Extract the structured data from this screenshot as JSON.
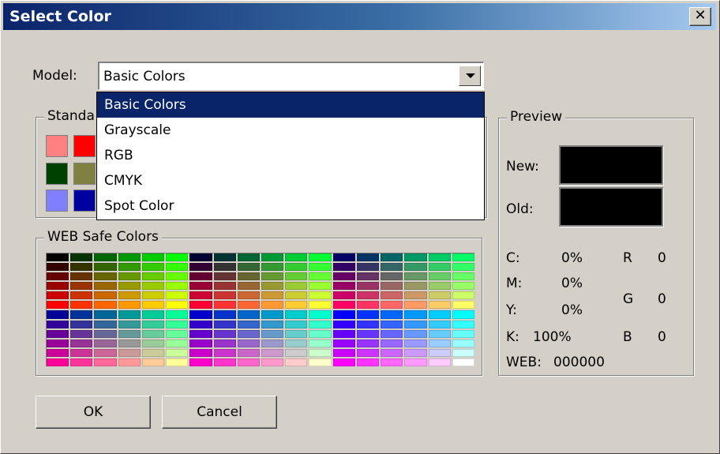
{
  "window": {
    "title": "Select Color"
  },
  "model": {
    "label": "Model:",
    "value": "Basic Colors",
    "options": [
      "Basic Colors",
      "Grayscale",
      "RGB",
      "CMYK",
      "Spot Color"
    ]
  },
  "standard": {
    "title": "Standa",
    "swatches": [
      "#ff8080",
      "#ff0000",
      "#004000",
      "#808040",
      "#8080ff",
      "#0000a0"
    ]
  },
  "web_safe": {
    "title": "WEB Safe Colors"
  },
  "preview": {
    "title": "Preview",
    "new_label": "New:",
    "old_label": "Old:",
    "new_color": "#000000",
    "old_color": "#000000"
  },
  "values": {
    "c_label": "C:",
    "c_value": "0%",
    "m_label": "M:",
    "m_value": "0%",
    "y_label": "Y:",
    "y_value": "0%",
    "k_label": "K:",
    "k_value": "100%",
    "r_label": "R",
    "r_value": "0",
    "g_label": "G",
    "g_value": "0",
    "b_label": "B",
    "b_value": "0",
    "web_label": "WEB:",
    "web_value": "000000"
  },
  "buttons": {
    "ok": "OK",
    "cancel": "Cancel"
  }
}
